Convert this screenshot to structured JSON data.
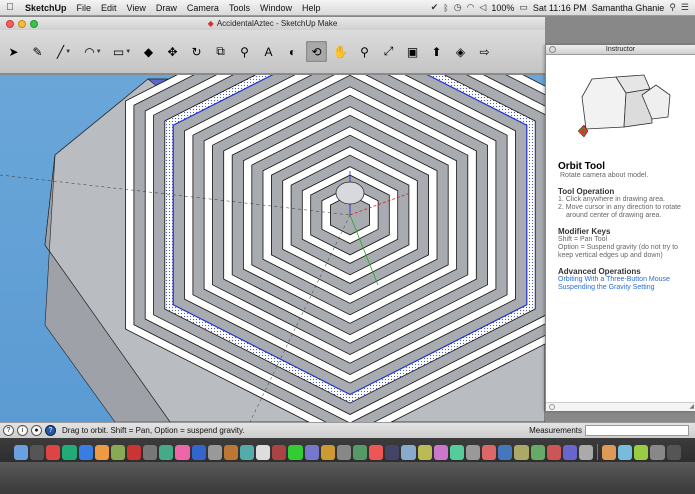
{
  "menubar": {
    "app_name": "SketchUp",
    "items": [
      "File",
      "Edit",
      "View",
      "Draw",
      "Camera",
      "Tools",
      "Window",
      "Help"
    ],
    "battery": "100%",
    "clock": "Sat 11:16 PM",
    "user": "Samantha Ghanie"
  },
  "window": {
    "title": "AccidentalAztec - SketchUp Make"
  },
  "toolbar": {
    "tools": [
      {
        "name": "select-tool",
        "icon": "➤"
      },
      {
        "name": "eraser-tool",
        "icon": "✎"
      },
      {
        "name": "pencil-tool",
        "icon": "╱"
      },
      {
        "name": "arc-tool",
        "icon": "◠"
      },
      {
        "name": "rectangle-tool",
        "icon": "▭"
      },
      {
        "name": "push-pull-tool",
        "icon": "◆"
      },
      {
        "name": "move-tool",
        "icon": "✥"
      },
      {
        "name": "rotate-tool",
        "icon": "↻"
      },
      {
        "name": "offset-tool",
        "icon": "⧉"
      },
      {
        "name": "tape-measure-tool",
        "icon": "⚲"
      },
      {
        "name": "text-tool",
        "icon": "A"
      },
      {
        "name": "paint-bucket-tool",
        "icon": "◐"
      },
      {
        "name": "orbit-tool",
        "icon": "⟲"
      },
      {
        "name": "pan-tool",
        "icon": "✋"
      },
      {
        "name": "zoom-tool",
        "icon": "⚲"
      },
      {
        "name": "zoom-extents-tool",
        "icon": "⤢"
      },
      {
        "name": "warehouse-tool",
        "icon": "▣"
      },
      {
        "name": "share-model-tool",
        "icon": "⬆"
      },
      {
        "name": "extension-warehouse-tool",
        "icon": "◈"
      },
      {
        "name": "send-to-layout-tool",
        "icon": "⇨"
      }
    ]
  },
  "instructor": {
    "header": "Instructor",
    "tool_title": "Orbit Tool",
    "tool_description": "Rotate camera about model.",
    "operation_heading": "Tool Operation",
    "operations": [
      "1.  Click anywhere in drawing area.",
      "2.  Move cursor in any direction to rotate around center of drawing area."
    ],
    "modifier_heading": "Modifier Keys",
    "modifiers": [
      "Shift = Pan Tool",
      "Option = Suspend gravity (do not try to keep vertical edges up and down)"
    ],
    "advanced_heading": "Advanced Operations",
    "advanced_links": [
      "Orbiting With a Three-Button Mouse",
      "Suspending the Gravity Setting"
    ]
  },
  "statusbar": {
    "message": "Drag to orbit. Shift = Pan, Option = suspend gravity.",
    "measurements_label": "Measurements"
  },
  "colors": {
    "sky": "#5b9bd3",
    "selection_edge": "#2233cc"
  }
}
